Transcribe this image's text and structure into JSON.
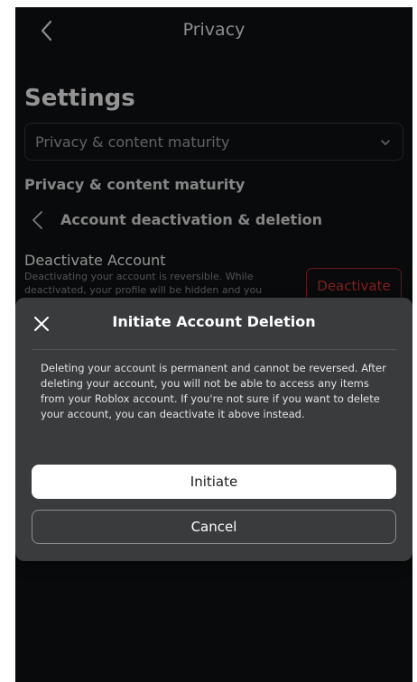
{
  "header": {
    "title": "Privacy",
    "back_icon": "chevron-left-icon"
  },
  "page": {
    "settings_title": "Settings",
    "category_select": {
      "value": "Privacy & content maturity",
      "icon": "chevron-down-icon"
    },
    "section_label": "Privacy & content maturity",
    "subnav": {
      "label": "Account deactivation & deletion",
      "back_icon": "chevron-left-icon"
    },
    "deactivate": {
      "title": "Deactivate Account",
      "description_line1": "Deactivating your account is reversible. While",
      "description_line2": "deactivated, your profile will be hidden and you",
      "button_label": "Deactivate"
    }
  },
  "modal": {
    "title": "Initiate Account Deletion",
    "close_icon": "close-icon",
    "body": "Deleting your account is permanent and cannot be reversed. After deleting your account, you will not be able to access any items from your Roblox account. If you're not sure if you want to delete your account, you can deactivate it above instead.",
    "initiate_label": "Initiate",
    "cancel_label": "Cancel"
  },
  "colors": {
    "background": "#111213",
    "modal_background": "#393b3d",
    "danger": "#d9363c",
    "primary_button": "#ffffff"
  }
}
